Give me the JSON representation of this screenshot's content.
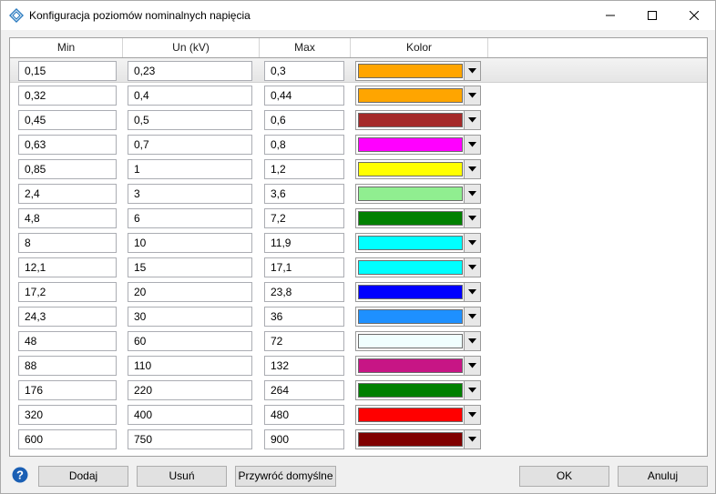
{
  "window": {
    "title": "Konfiguracja poziomów nominalnych napięcia",
    "icons": {
      "app": "diamond-logo-icon",
      "minimize": "minimize-icon",
      "maximize": "maximize-icon",
      "close": "close-icon"
    }
  },
  "grid": {
    "columns": [
      "Min",
      "Un (kV)",
      "Max",
      "Kolor"
    ],
    "rows": [
      {
        "min": "0,15",
        "un": "0,23",
        "max": "0,3",
        "color": "#ffa500"
      },
      {
        "min": "0,32",
        "un": "0,4",
        "max": "0,44",
        "color": "#ffa500"
      },
      {
        "min": "0,45",
        "un": "0,5",
        "max": "0,6",
        "color": "#a52a2a"
      },
      {
        "min": "0,63",
        "un": "0,7",
        "max": "0,8",
        "color": "#ff00ff"
      },
      {
        "min": "0,85",
        "un": "1",
        "max": "1,2",
        "color": "#ffff00"
      },
      {
        "min": "2,4",
        "un": "3",
        "max": "3,6",
        "color": "#90ee90"
      },
      {
        "min": "4,8",
        "un": "6",
        "max": "7,2",
        "color": "#008000"
      },
      {
        "min": "8",
        "un": "10",
        "max": "11,9",
        "color": "#00ffff"
      },
      {
        "min": "12,1",
        "un": "15",
        "max": "17,1",
        "color": "#00ffff"
      },
      {
        "min": "17,2",
        "un": "20",
        "max": "23,8",
        "color": "#0000ff"
      },
      {
        "min": "24,3",
        "un": "30",
        "max": "36",
        "color": "#1e90ff"
      },
      {
        "min": "48",
        "un": "60",
        "max": "72",
        "color": "#f0ffff"
      },
      {
        "min": "88",
        "un": "110",
        "max": "132",
        "color": "#c71585"
      },
      {
        "min": "176",
        "un": "220",
        "max": "264",
        "color": "#008000"
      },
      {
        "min": "320",
        "un": "400",
        "max": "480",
        "color": "#ff0000"
      },
      {
        "min": "600",
        "un": "750",
        "max": "900",
        "color": "#800000"
      }
    ],
    "selected_row": 0
  },
  "buttons": {
    "help_icon": "help-icon",
    "add": "Dodaj",
    "remove": "Usuń",
    "restore_defaults": "Przywróć domyślne",
    "ok": "OK",
    "cancel": "Anuluj"
  }
}
